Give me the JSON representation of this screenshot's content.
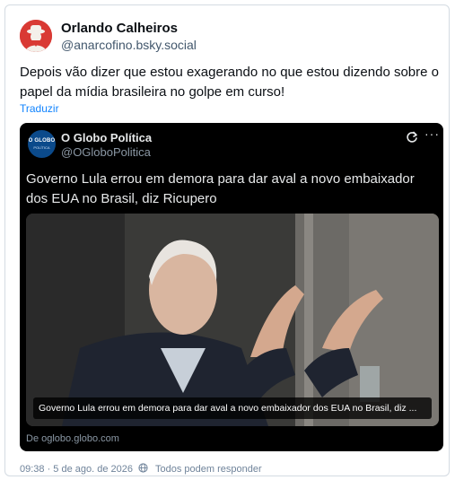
{
  "post": {
    "author_name": "Orlando Calheiros",
    "author_handle": "@anarcofino.bsky.social",
    "text": "Depois vão dizer que estou exagerando no que estou dizendo sobre o papel da mídia brasileira no golpe em curso!",
    "translate_label": "Traduzir",
    "timestamp": "09:38 · 5 de ago. de 2026",
    "reply_setting": "Todos podem responder"
  },
  "embed": {
    "avatar_line1": "O GLOBO",
    "avatar_line2": "POLÍTICA",
    "name": "O Globo Política",
    "handle": "@OGloboPolitica",
    "more_label": "···",
    "headline": "Governo Lula errou em demora para dar aval a novo embaixador dos EUA no Brasil, diz Ricupero",
    "photo_caption": "Governo Lula errou em demora para dar aval a novo embaixador dos EUA no Brasil, diz ...",
    "source": "De oglobo.globo.com"
  },
  "colors": {
    "accent": "#1083fe",
    "border": "#d4dbe2",
    "muted": "#6f839a",
    "embed_bg": "#000000"
  },
  "icons": [
    "refresh-icon",
    "more-icon",
    "globe-icon"
  ]
}
